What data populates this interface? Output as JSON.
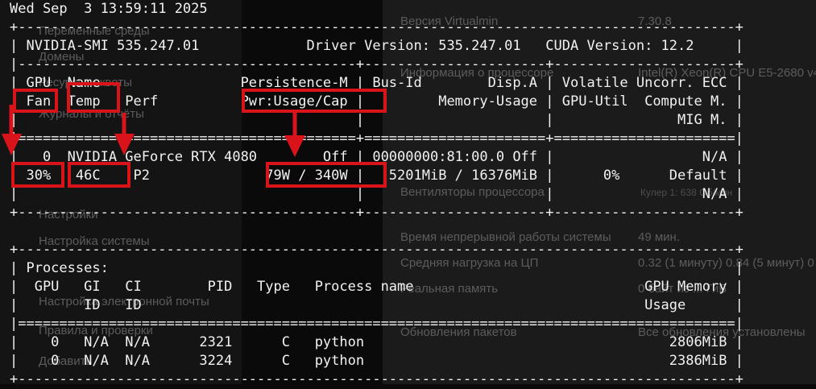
{
  "background_window": {
    "left_items": [
      "Переменные среды",
      "Домены",
      "Ресурсы и квоты",
      "Журналы и отчёты",
      "Настройки",
      "Настройка системы",
      "Настройка электронной почты",
      "Правила и проверки",
      "Добавить"
    ],
    "right_rows": [
      {
        "label": "Версия Virtualmin",
        "value": "7.30.8"
      },
      {
        "label": "Информация о процессоре",
        "value": "Intel(R) Xeon(R) CPU E5-2680 v4 @"
      },
      {
        "label": "Вентиляторы процессора",
        "value": "Кулер 1: 638 Об/мин"
      },
      {
        "label": "Время непрерывной работы системы",
        "value": "49 мин."
      },
      {
        "label": "Средняя нагрузка на ЦП",
        "value": "0.32 (1 минуту) 0.84 (5 минут) 0"
      },
      {
        "label": "Реальная память",
        "value": "0 байт из ... ГиБ"
      },
      {
        "label": "Обновления пакетов",
        "value": "Все обновления установлены"
      }
    ]
  },
  "terminal": {
    "lines": [
      "Wed Sep  3 13:59:11 2025",
      "+---------------------------------------------------------------------------------------+",
      "| NVIDIA-SMI 535.247.01             Driver Version: 535.247.01   CUDA Version: 12.2     |",
      "|-----------------------------------------+----------------------+----------------------+",
      "| GPU  Name                 Persistence-M | Bus-Id        Disp.A | Volatile Uncorr. ECC |",
      "| Fan  Temp   Perf          Pwr:Usage/Cap |         Memory-Usage | GPU-Util  Compute M. |",
      "|                                         |                      |               MIG M. |",
      "|=========================================+======================+======================|",
      "|   0  NVIDIA GeForce RTX 4080        Off | 00000000:81:00.0 Off |                  N/A |",
      "| 30%   46C    P2              79W / 340W |   5201MiB / 16376MiB |      0%      Default |",
      "|                                         |                      |                  N/A |",
      "+-----------------------------------------+----------------------+----------------------+",
      "",
      "+---------------------------------------------------------------------------------------+",
      "| Processes:                                                                            |",
      "|  GPU   GI   CI        PID   Type   Process name                            GPU Memory |",
      "|        ID   ID                                                             Usage      |",
      "|=======================================================================================|",
      "|    0   N/A  N/A      2321      C   python                                     2806MiB |",
      "|    0   N/A  N/A      3224      C   python                                     2386MiB |",
      "+---------------------------------------------------------------------------------------+"
    ]
  },
  "annotations": {
    "color": "#d8141a",
    "highlighted": [
      {
        "name": "fan-header",
        "text": "Fan"
      },
      {
        "name": "temp-header",
        "text": "Temp"
      },
      {
        "name": "power-header",
        "text": "Pwr:Usage/Cap"
      },
      {
        "name": "fan-value",
        "text": "30%"
      },
      {
        "name": "temp-value",
        "text": "46C"
      },
      {
        "name": "power-value",
        "text": "79W / 340W"
      }
    ]
  }
}
